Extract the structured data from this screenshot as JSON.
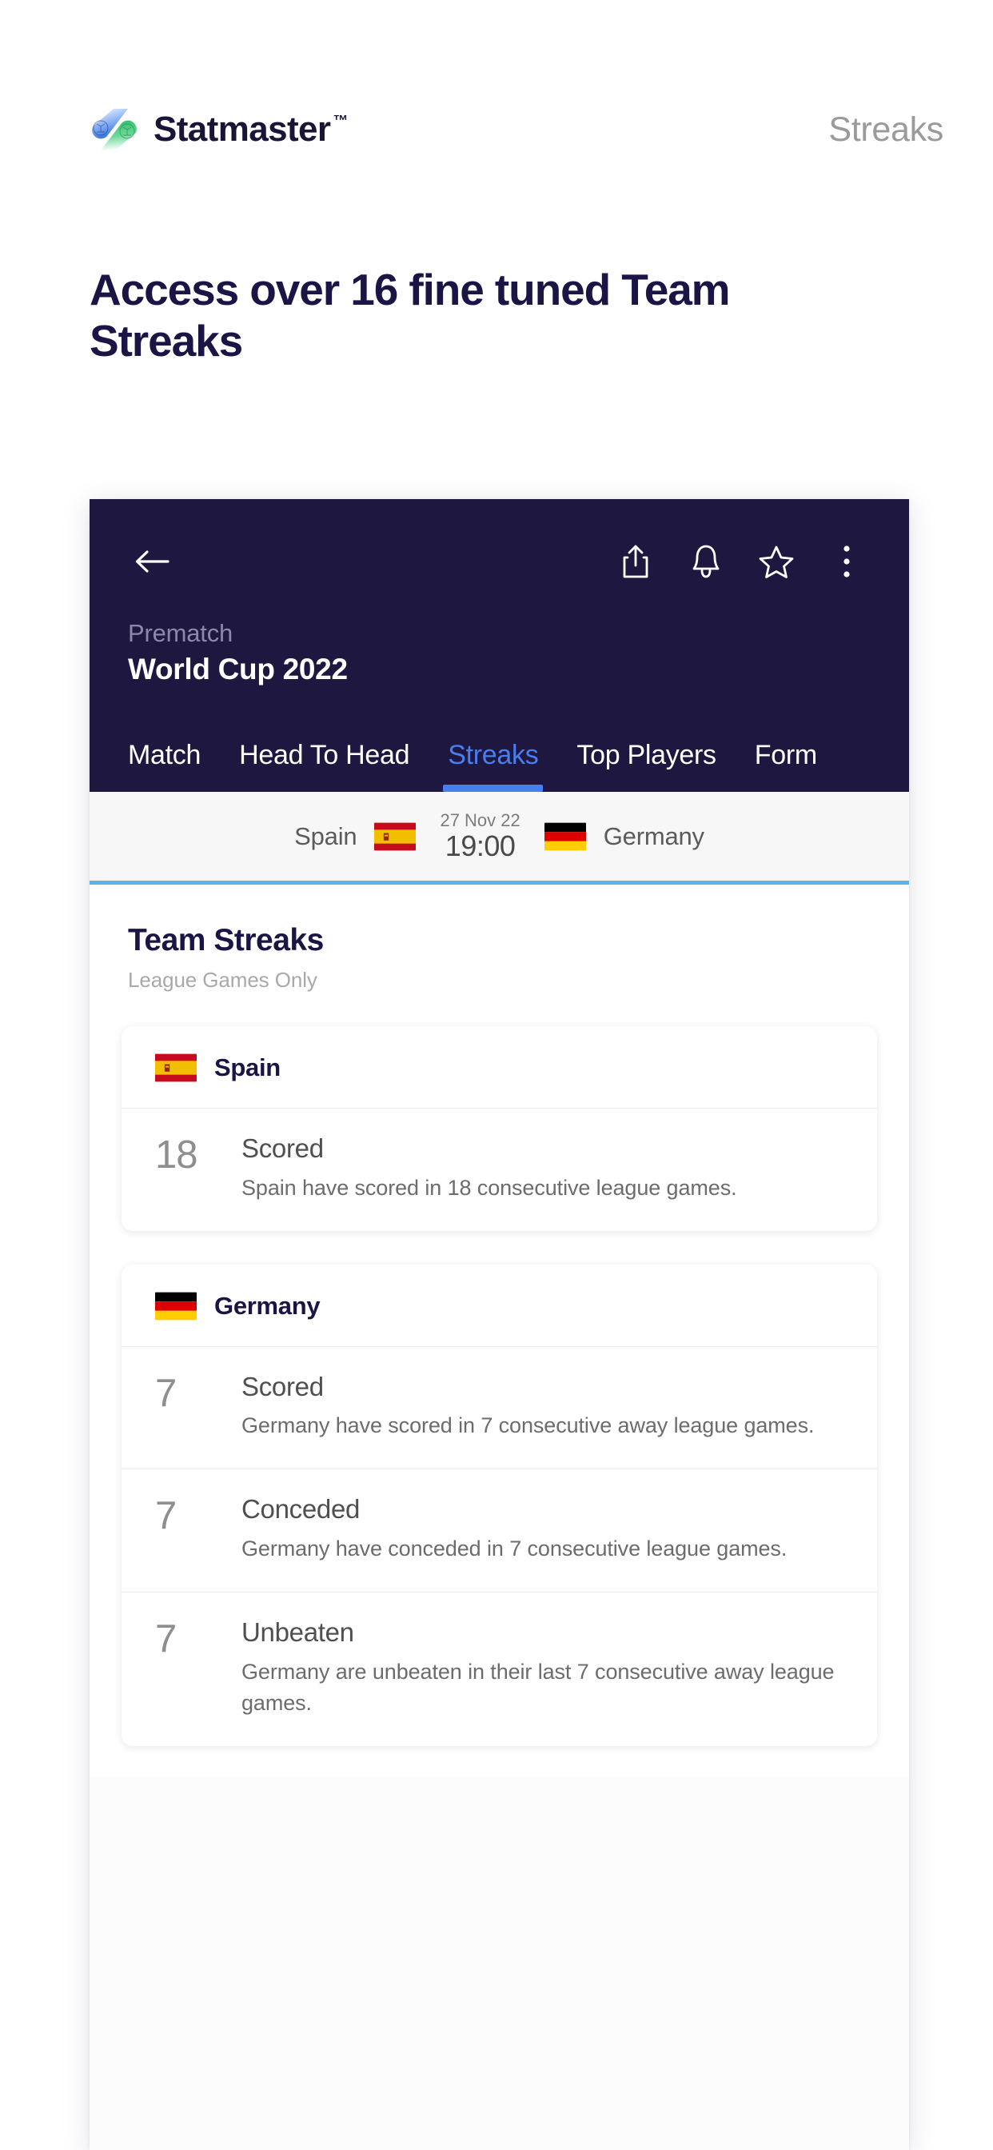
{
  "page": {
    "brand_name": "Statmaster",
    "brand_tm": "™",
    "brand_logo_icon": "statmaster-logo-icon",
    "header_right_label": "Streaks",
    "hero_heading": "Access over 16 fine tuned Team Streaks"
  },
  "app": {
    "back_icon": "back-arrow-icon",
    "actions": [
      {
        "name": "share-icon",
        "label": "Share"
      },
      {
        "name": "bell-icon",
        "label": "Notifications"
      },
      {
        "name": "star-icon",
        "label": "Favourite"
      },
      {
        "name": "more-vertical-icon",
        "label": "More"
      }
    ],
    "status": "Prematch",
    "competition": "World Cup 2022",
    "tabs": [
      {
        "label": "Match",
        "active": false
      },
      {
        "label": "Head To Head",
        "active": false
      },
      {
        "label": "Streaks",
        "active": true
      },
      {
        "label": "Top Players",
        "active": false
      },
      {
        "label": "Form",
        "active": false
      }
    ],
    "accent_color": "#4a7dee",
    "header_color": "#1e1840",
    "divider_color": "#56b5ec"
  },
  "match": {
    "home_team": "Spain",
    "home_flag": "spain-flag-icon",
    "away_team": "Germany",
    "away_flag": "germany-flag-icon",
    "date": "27 Nov 22",
    "time": "19:00"
  },
  "streaks": {
    "title": "Team Streaks",
    "subtitle": "League Games Only",
    "cards": [
      {
        "team": "Spain",
        "flag": "spain-flag-icon",
        "rows": [
          {
            "value": "18",
            "label": "Scored",
            "description": "Spain have scored in 18 consecutive league games."
          }
        ]
      },
      {
        "team": "Germany",
        "flag": "germany-flag-icon",
        "rows": [
          {
            "value": "7",
            "label": "Scored",
            "description": "Germany have scored in 7 consecutive away league games."
          },
          {
            "value": "7",
            "label": "Conceded",
            "description": "Germany have conceded in 7 consecutive league games."
          },
          {
            "value": "7",
            "label": "Unbeaten",
            "description": "Germany are unbeaten in their last 7 consecutive away league games."
          }
        ]
      }
    ]
  }
}
